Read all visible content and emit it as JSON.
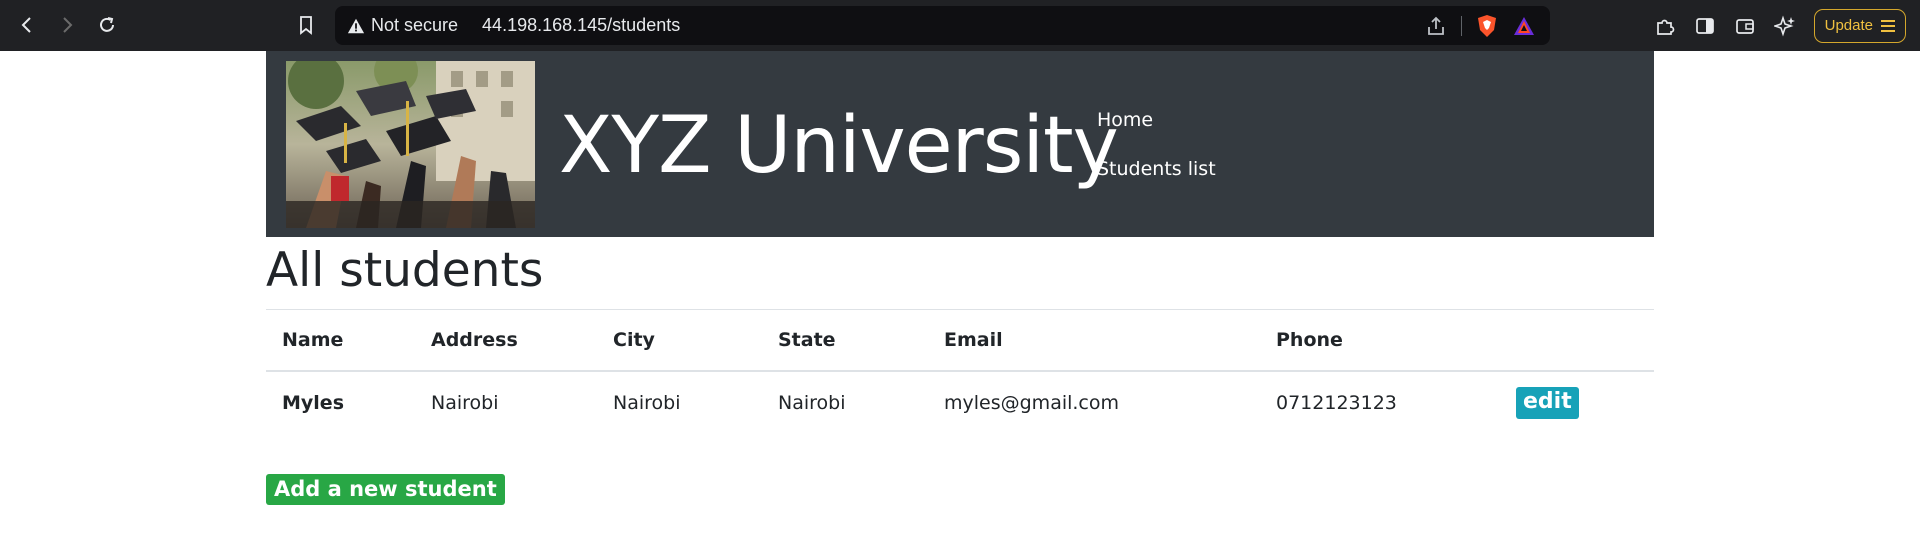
{
  "browser": {
    "security_label": "Not secure",
    "url": "44.198.168.145/students",
    "update_label": "Update"
  },
  "header": {
    "title": "XYZ University",
    "nav": [
      {
        "label": "Home"
      },
      {
        "label": "Students list"
      }
    ]
  },
  "main": {
    "heading": "All students",
    "table": {
      "columns": [
        "Name",
        "Address",
        "City",
        "State",
        "Email",
        "Phone",
        ""
      ],
      "rows": [
        {
          "name": "Myles",
          "address": "Nairobi",
          "city": "Nairobi",
          "state": "Nairobi",
          "email": "myles@gmail.com",
          "phone": "0712123123",
          "action": "edit"
        }
      ]
    },
    "add_button": "Add a new student"
  },
  "colors": {
    "banner_bg": "#343a40",
    "edit_button": "#17a2b8",
    "add_button": "#28a745"
  }
}
